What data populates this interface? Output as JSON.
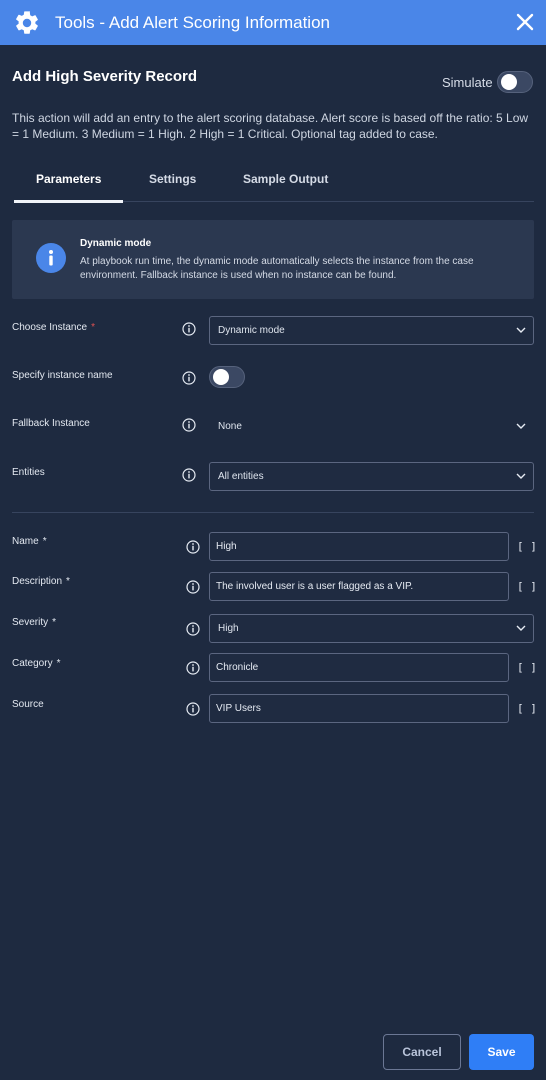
{
  "window": {
    "title": "Tools - Add Alert Scoring Information",
    "accent_color": "#4a86e8"
  },
  "header": {
    "record_title": "Add High Severity Record",
    "simulate_label": "Simulate",
    "simulate_on": false
  },
  "description": "This action will add an entry to the alert scoring database. Alert score is based off the ratio: 5 Low = 1 Medium. 3 Medium = 1 High. 2 High = 1 Critical. Optional tag added to case.",
  "tabs": [
    {
      "label": "Parameters",
      "active": true
    },
    {
      "label": "Settings",
      "active": false
    },
    {
      "label": "Sample Output",
      "active": false
    }
  ],
  "info_box": {
    "title": "Dynamic mode",
    "text": "At playbook run time, the dynamic mode automatically selects the instance from the case environment. Fallback instance is used when no instance can be found."
  },
  "instance_fields": {
    "choose_instance": {
      "label": "Choose Instance",
      "required_mark": "*",
      "value": "Dynamic mode"
    },
    "specify_instance_name": {
      "label": "Specify instance name",
      "on": false
    },
    "fallback_instance": {
      "label": "Fallback Instance",
      "value": "None"
    },
    "entities": {
      "label": "Entities",
      "value": "All entities"
    }
  },
  "params": {
    "name": {
      "label": "Name",
      "required_mark": "*",
      "value": "High"
    },
    "description": {
      "label": "Description",
      "required_mark": "*",
      "value": "The involved user is a user flagged as a VIP."
    },
    "severity": {
      "label": "Severity",
      "required_mark": "*",
      "value": "High"
    },
    "category": {
      "label": "Category",
      "required_mark": "*",
      "value": "Chronicle"
    },
    "source": {
      "label": "Source",
      "value": "VIP Users"
    }
  },
  "brackets_symbol": "[ ]",
  "footer": {
    "cancel_label": "Cancel",
    "save_label": "Save"
  }
}
